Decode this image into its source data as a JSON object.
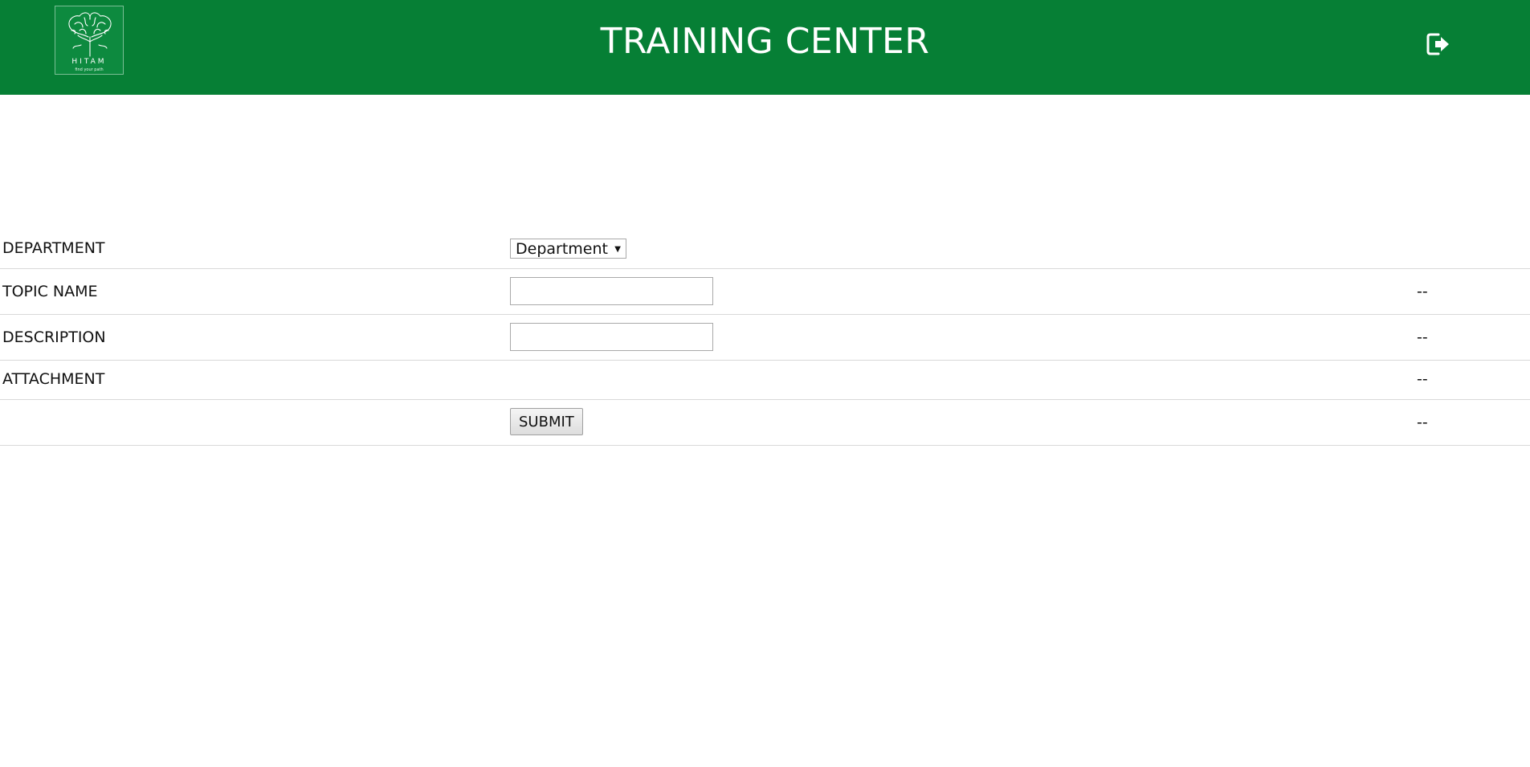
{
  "header": {
    "title": "TRAINING CENTER",
    "logo_word": "HITAM",
    "logo_tagline": "find your path",
    "logout_icon": "sign-out-icon",
    "background_color": "#067f35"
  },
  "form": {
    "rows": [
      {
        "label": "DEPARTMENT",
        "select_value": "Department",
        "status": ""
      },
      {
        "label": "TOPIC NAME",
        "value": "",
        "status": "--"
      },
      {
        "label": "DESCRIPTION",
        "value": "",
        "status": "--"
      },
      {
        "label": "ATTACHMENT",
        "status": "--"
      },
      {
        "label": "",
        "button_label": "SUBMIT",
        "status": "--"
      }
    ]
  }
}
